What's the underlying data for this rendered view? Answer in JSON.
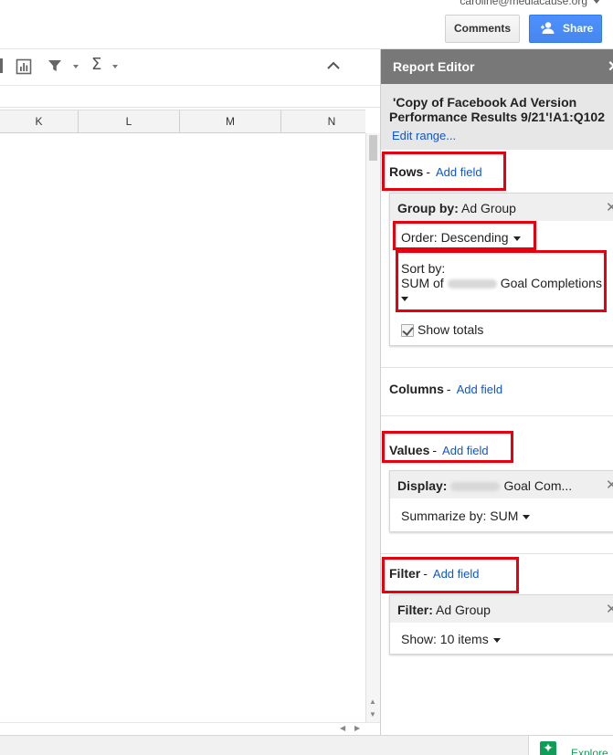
{
  "account": {
    "email": "caroline@mediacause.org"
  },
  "header": {
    "comments_label": "Comments",
    "share_label": "Share"
  },
  "sheet": {
    "columns": [
      "K",
      "L",
      "M",
      "N"
    ]
  },
  "explore": {
    "label": "Explore"
  },
  "report_editor": {
    "title": "Report Editor",
    "source_line1": "'Copy of Facebook Ad Version",
    "source_line2": "Performance Results 9/21'!A1:Q102",
    "edit_range": "Edit range...",
    "rows": {
      "label": "Rows",
      "dash": "-",
      "add": "Add field",
      "group_by_key": "Group by:",
      "group_by_value": "Ad Group",
      "order": "Order: Descending",
      "sort_by_label": "Sort by:",
      "sort_by_prefix": "SUM of",
      "sort_by_suffix": "Goal Completions",
      "show_totals": "Show totals"
    },
    "columns": {
      "label": "Columns",
      "dash": "-",
      "add": "Add field"
    },
    "values": {
      "label": "Values",
      "dash": "-",
      "add": "Add field",
      "display_key": "Display:",
      "display_suffix": "Goal Com...",
      "summarize": "Summarize by: SUM"
    },
    "filter": {
      "label": "Filter",
      "dash": "-",
      "add": "Add field",
      "filter_key": "Filter:",
      "filter_value": "Ad Group",
      "show": "Show: 10 items"
    }
  }
}
